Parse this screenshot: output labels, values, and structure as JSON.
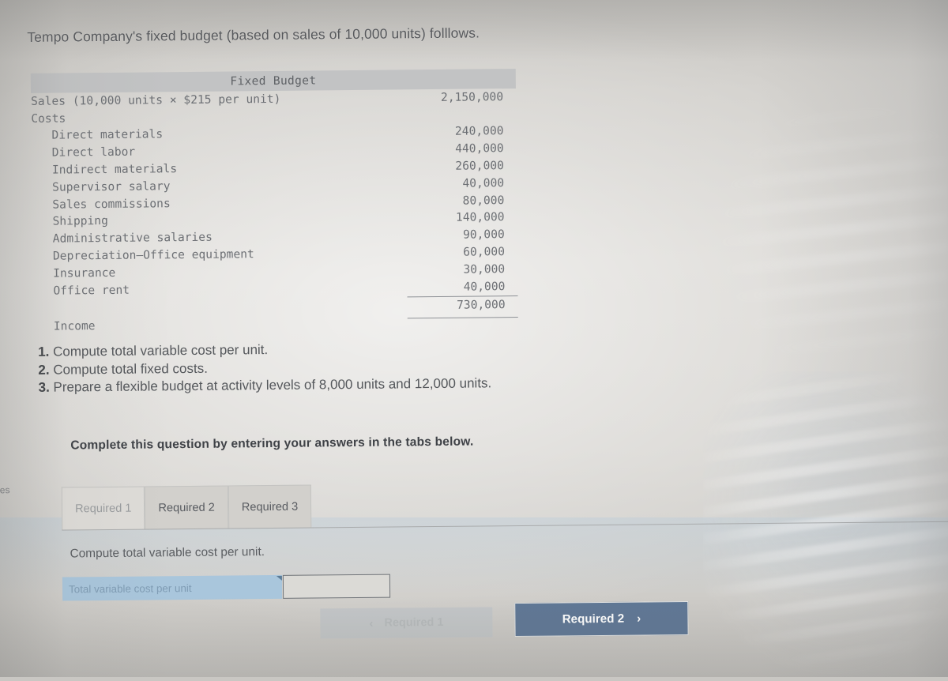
{
  "prompt": "Tempo Company's fixed budget (based on sales of 10,000 units) folllows.",
  "budget": {
    "header": "Fixed Budget",
    "sales_label": "Sales (10,000 units × $215 per unit)",
    "sales_value": "2,150,000",
    "costs_label": "Costs",
    "cost_rows": [
      {
        "label": "Direct materials",
        "value": "240,000"
      },
      {
        "label": "Direct labor",
        "value": "440,000"
      },
      {
        "label": "Indirect materials",
        "value": "260,000"
      },
      {
        "label": "Supervisor salary",
        "value": "40,000"
      },
      {
        "label": "Sales commissions",
        "value": "80,000"
      },
      {
        "label": "Shipping",
        "value": "140,000"
      },
      {
        "label": "Administrative salaries",
        "value": "90,000"
      },
      {
        "label": "Depreciation–Office equipment",
        "value": "60,000"
      },
      {
        "label": "Insurance",
        "value": "30,000"
      },
      {
        "label": "Office rent",
        "value": "40,000"
      }
    ],
    "income_label": "Income",
    "income_value": "730,000"
  },
  "requirements": [
    {
      "num": "1.",
      "text": "Compute total variable cost per unit."
    },
    {
      "num": "2.",
      "text": "Compute total fixed costs."
    },
    {
      "num": "3.",
      "text": "Prepare a flexible budget at activity levels of 8,000 units and 12,000 units."
    }
  ],
  "instruction": "Complete this question by entering your answers in the tabs below.",
  "tabs": [
    {
      "label": "Required 1",
      "active": true
    },
    {
      "label": "Required 2",
      "active": false
    },
    {
      "label": "Required 3",
      "active": false
    }
  ],
  "answer_panel": {
    "sub_prompt": "Compute total variable cost per unit.",
    "row_label": "Total variable cost per unit",
    "input_value": "",
    "input_placeholder": ""
  },
  "nav": {
    "prev_label": "Required 1",
    "prev_chevron": "‹",
    "next_label": "Required 2",
    "next_chevron": "›"
  },
  "edge_fragment": "es",
  "colors": {
    "page_background": "#d4d2ce",
    "table_header_band": "#c2c3c4",
    "answer_label_fill": "#a9c6dc",
    "next_button": "#5f7795",
    "prev_button": "#c3c6c8",
    "body_text": "#55585c",
    "mono_text": "#6c6f74"
  }
}
